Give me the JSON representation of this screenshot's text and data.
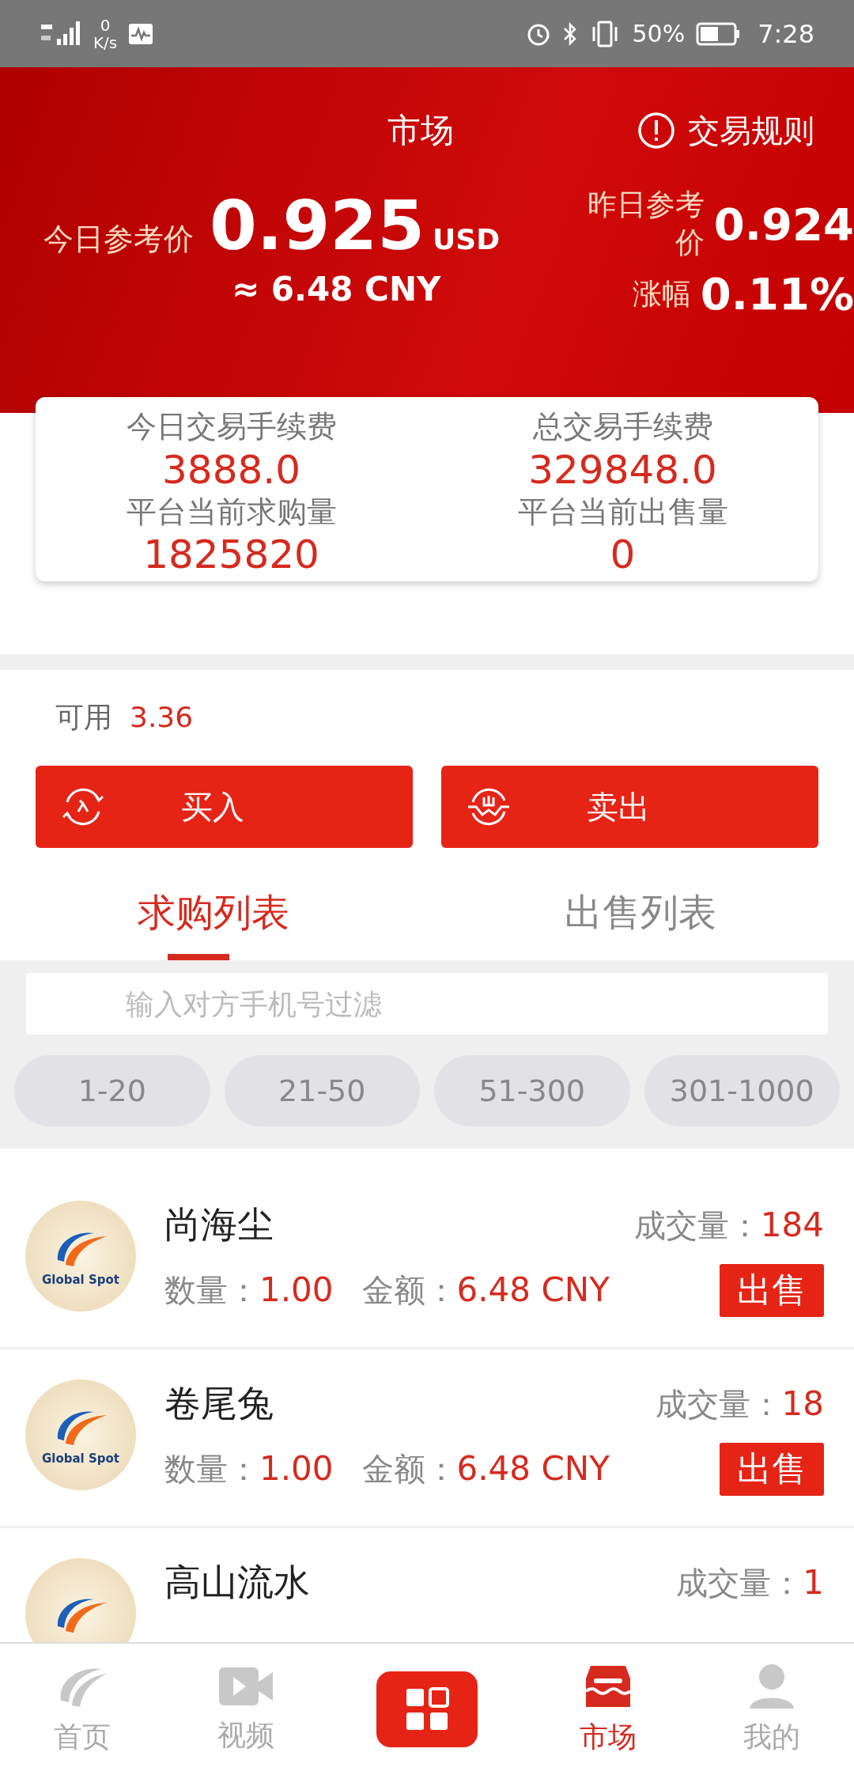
{
  "status_bar": {
    "speed_value": "0",
    "speed_unit": "K/s",
    "battery": "50%",
    "time": "7:28"
  },
  "header": {
    "title": "市场",
    "rules_link": "交易规则",
    "today_label": "今日参考价",
    "today_price": "0.925",
    "today_unit": "USD",
    "today_cny": "≈ 6.48 CNY",
    "yesterday_label": "昨日参考价",
    "yesterday_price": "0.924",
    "change_label": "涨幅",
    "change_value": "0.11%"
  },
  "stats": [
    {
      "label": "今日交易手续费",
      "value": "3888.0"
    },
    {
      "label": "总交易手续费",
      "value": "329848.0"
    },
    {
      "label": "平台当前求购量",
      "value": "1825820"
    },
    {
      "label": "平台当前出售量",
      "value": "0"
    }
  ],
  "balance": {
    "label": "可用",
    "value": "3.36"
  },
  "actions": [
    {
      "kind": "buy",
      "label": "买入"
    },
    {
      "kind": "sell",
      "label": "卖出"
    }
  ],
  "tabs": [
    {
      "label": "求购列表",
      "selected": true
    },
    {
      "label": "出售列表",
      "selected": false
    }
  ],
  "search": {
    "placeholder": "输入对方手机号过滤"
  },
  "ranges": [
    {
      "label": "1-20",
      "selected": false
    },
    {
      "label": "21-50",
      "selected": false
    },
    {
      "label": "51-300",
      "selected": false
    },
    {
      "label": "301-1000",
      "selected": false
    }
  ],
  "orders": [
    {
      "logo_text": "Global Spot",
      "name": "尚海尘",
      "deals_label": "成交量：",
      "deals": "184",
      "qty_label": "数量：",
      "qty": "1.00",
      "amount_label": "金额：",
      "amount": "6.48 CNY",
      "action": "出售"
    },
    {
      "logo_text": "Global Spot",
      "name": "卷尾兔",
      "deals_label": "成交量：",
      "deals": "18",
      "qty_label": "数量：",
      "qty": "1.00",
      "amount_label": "金额：",
      "amount": "6.48 CNY",
      "action": "出售"
    },
    {
      "name": "高山流水",
      "deals_label": "成交量：",
      "deals": "1"
    }
  ],
  "nav": [
    {
      "kind": "home",
      "label": "首页",
      "selected": false
    },
    {
      "kind": "video",
      "label": "视频",
      "selected": false
    },
    {
      "kind": "center",
      "selected": false
    },
    {
      "kind": "market",
      "label": "市场",
      "selected": true
    },
    {
      "kind": "profile",
      "label": "我的",
      "selected": false
    }
  ]
}
